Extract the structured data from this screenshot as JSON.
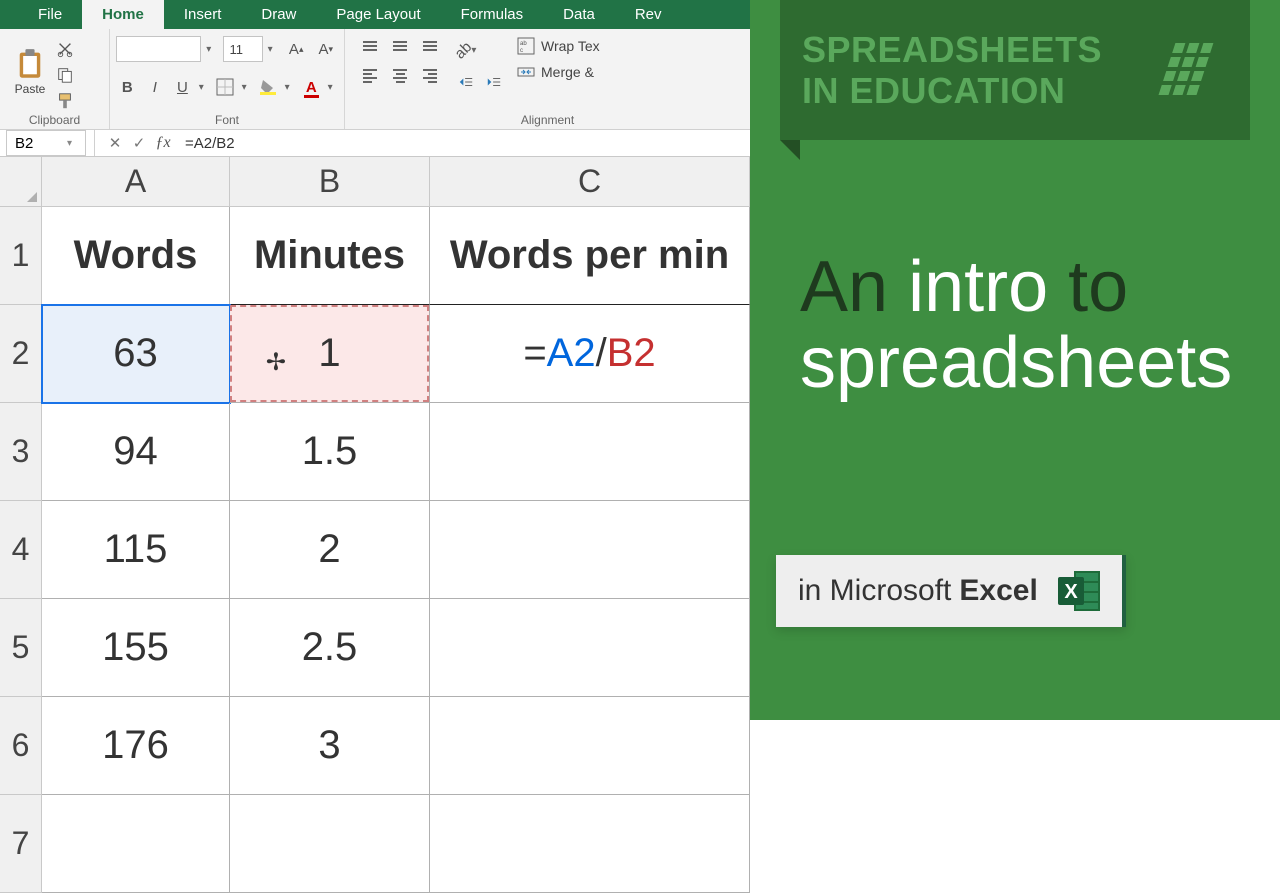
{
  "tabs": {
    "file": "File",
    "home": "Home",
    "insert": "Insert",
    "draw": "Draw",
    "pagelayout": "Page Layout",
    "formulas": "Formulas",
    "data": "Data",
    "review": "Rev"
  },
  "ribbon": {
    "paste": "Paste",
    "clipboard": "Clipboard",
    "font": "Font",
    "alignment": "Alignment",
    "font_size": "11",
    "bold": "B",
    "italic": "I",
    "underline": "U",
    "grow": "Aˆ",
    "shrink": "Aˇ",
    "wrap": "Wrap Tex",
    "merge": "Merge &"
  },
  "fbar": {
    "name": "B2",
    "formula": "=A2/B2"
  },
  "cols": {
    "a": "A",
    "b": "B",
    "c": "C"
  },
  "rows": [
    "1",
    "2",
    "3",
    "4",
    "5",
    "6",
    "7"
  ],
  "data": {
    "h_a": "Words",
    "h_b": "Minutes",
    "h_c": "Words per min",
    "a2": "63",
    "b2": "1",
    "c2_eq": "=",
    "c2_r1": "A2",
    "c2_op": "/",
    "c2_r2": "B2",
    "a3": "94",
    "b3": "1.5",
    "a4": "115",
    "b4": "2",
    "a5": "155",
    "b5": "2.5",
    "a6": "176",
    "b6": "3"
  },
  "promo": {
    "banner1": "SPREADSHEETS",
    "banner2": "IN EDUCATION",
    "t1": "An",
    "t2": "intro",
    "t3": "to",
    "t4": "spreadsheets",
    "sub_pre": "in Microsoft",
    "sub_bold": "Excel"
  }
}
